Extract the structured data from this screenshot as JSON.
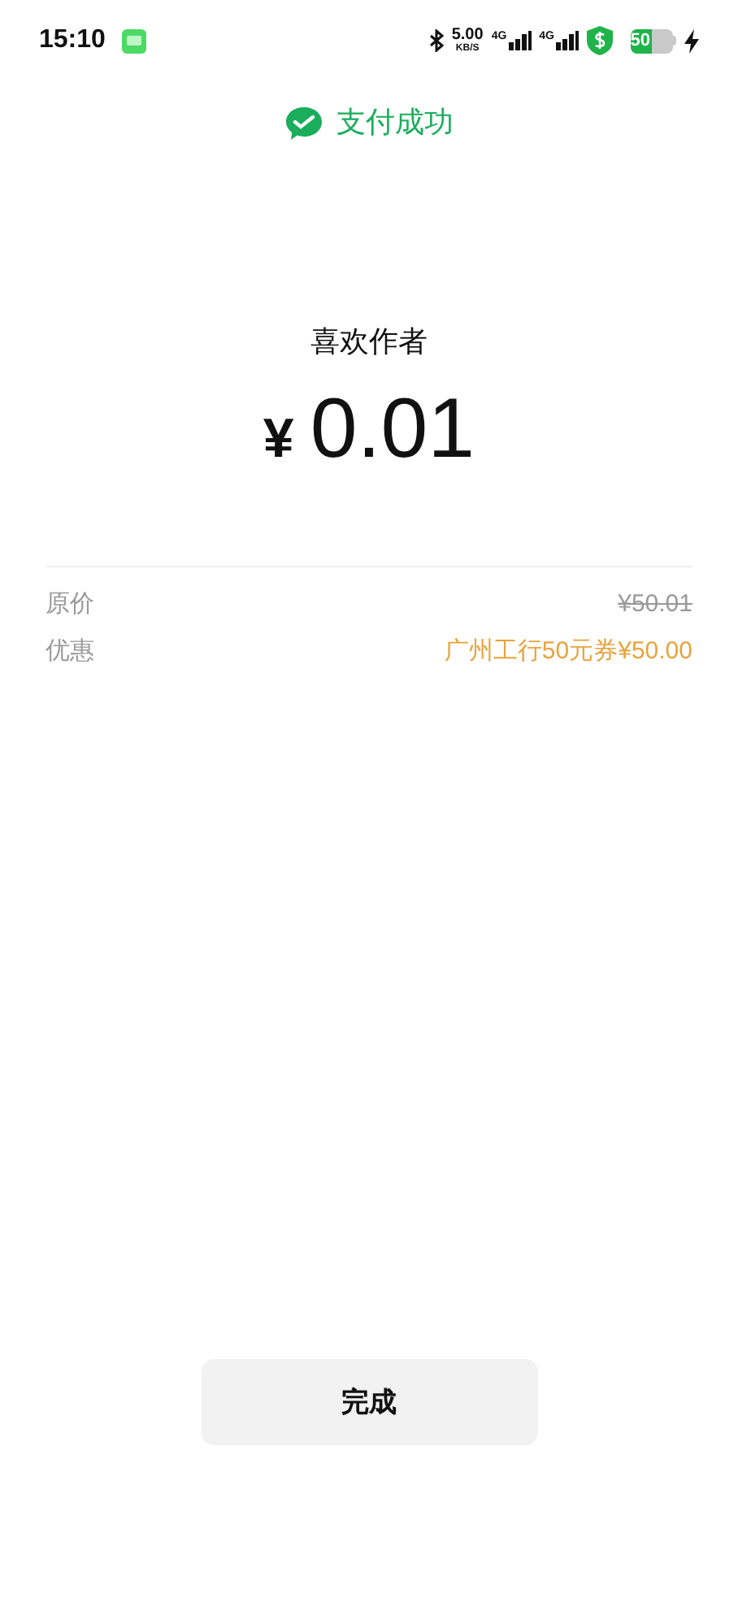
{
  "status_bar": {
    "time": "15:10",
    "speed": "5.00",
    "speed_unit": "KB/S",
    "networks": [
      "4G",
      "4G"
    ],
    "battery": "50"
  },
  "header": {
    "title": "支付成功"
  },
  "payee": "喜欢作者",
  "amount": {
    "currency": "¥",
    "value": "0.01"
  },
  "details": [
    {
      "kind": "original",
      "label": "原价",
      "value": "¥50.01"
    },
    {
      "kind": "discount",
      "label": "优惠",
      "value": "广州工行50元券¥50.00"
    }
  ],
  "done_button": "完成"
}
